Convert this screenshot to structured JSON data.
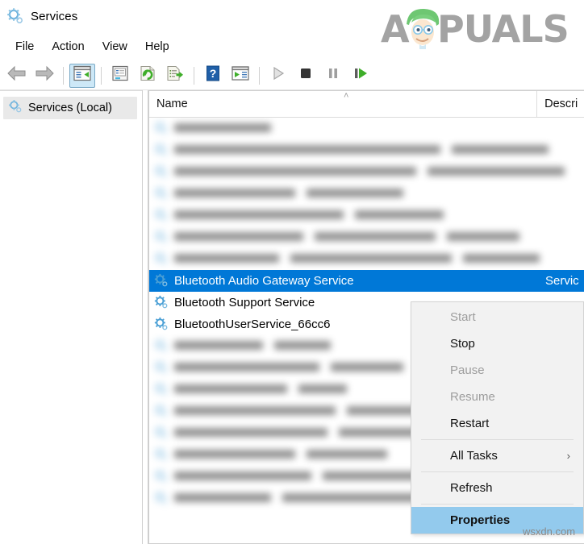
{
  "window": {
    "title": "Services",
    "icon": "services-gear-icon"
  },
  "menubar": {
    "items": [
      {
        "label": "File"
      },
      {
        "label": "Action"
      },
      {
        "label": "View"
      },
      {
        "label": "Help"
      }
    ]
  },
  "toolbar": {
    "buttons": [
      {
        "name": "back-icon",
        "tip": "Back"
      },
      {
        "name": "forward-icon",
        "tip": "Forward"
      },
      {
        "name": "show-hide-console-tree-icon",
        "tip": "Show/Hide Console Tree",
        "active": true
      },
      {
        "name": "properties-icon",
        "tip": "Properties"
      },
      {
        "name": "refresh-icon",
        "tip": "Refresh"
      },
      {
        "name": "export-list-icon",
        "tip": "Export List"
      },
      {
        "name": "help-icon",
        "tip": "Help"
      },
      {
        "name": "show-action-pane-icon",
        "tip": "Show/Hide Action Pane"
      },
      {
        "name": "start-service-icon",
        "tip": "Start Service"
      },
      {
        "name": "stop-service-icon",
        "tip": "Stop Service"
      },
      {
        "name": "pause-service-icon",
        "tip": "Pause Service"
      },
      {
        "name": "restart-service-icon",
        "tip": "Restart Service"
      }
    ]
  },
  "tree": {
    "root_label": "Services (Local)"
  },
  "list": {
    "columns": [
      {
        "key": "name",
        "label": "Name",
        "sorted": "ascending",
        "sort_glyph": "˄"
      },
      {
        "key": "description",
        "label": "Descri"
      }
    ],
    "rows": [
      {
        "name": "",
        "description": "",
        "blurred": true,
        "selected": false
      },
      {
        "name": "",
        "description": "",
        "blurred": true,
        "selected": false
      },
      {
        "name": "",
        "description": "",
        "blurred": true,
        "selected": false
      },
      {
        "name": "",
        "description": "",
        "blurred": true,
        "selected": false
      },
      {
        "name": "",
        "description": "",
        "blurred": true,
        "selected": false
      },
      {
        "name": "",
        "description": "",
        "blurred": true,
        "selected": false
      },
      {
        "name": "",
        "description": "",
        "blurred": true,
        "selected": false
      },
      {
        "name": "Bluetooth Audio Gateway Service",
        "description": "Servic",
        "blurred": false,
        "selected": true
      },
      {
        "name": "Bluetooth Support Service",
        "description": "",
        "blurred": false,
        "selected": false
      },
      {
        "name": "BluetoothUserService_66cc6",
        "description": "",
        "blurred": false,
        "selected": false
      },
      {
        "name": "",
        "description": "",
        "blurred": true,
        "selected": false
      },
      {
        "name": "",
        "description": "",
        "blurred": true,
        "selected": false
      },
      {
        "name": "",
        "description": "",
        "blurred": true,
        "selected": false
      },
      {
        "name": "",
        "description": "",
        "blurred": true,
        "selected": false
      },
      {
        "name": "",
        "description": "",
        "blurred": true,
        "selected": false
      },
      {
        "name": "",
        "description": "",
        "blurred": true,
        "selected": false
      },
      {
        "name": "",
        "description": "",
        "blurred": true,
        "selected": false
      },
      {
        "name": "",
        "description": "",
        "blurred": true,
        "selected": false
      }
    ]
  },
  "context_menu": {
    "items": [
      {
        "label": "Start",
        "disabled": true,
        "highlight": false,
        "separator_after": false,
        "submenu": false
      },
      {
        "label": "Stop",
        "disabled": false,
        "highlight": false,
        "separator_after": false,
        "submenu": false
      },
      {
        "label": "Pause",
        "disabled": true,
        "highlight": false,
        "separator_after": false,
        "submenu": false
      },
      {
        "label": "Resume",
        "disabled": true,
        "highlight": false,
        "separator_after": false,
        "submenu": false
      },
      {
        "label": "Restart",
        "disabled": false,
        "highlight": false,
        "separator_after": true,
        "submenu": false
      },
      {
        "label": "All Tasks",
        "disabled": false,
        "highlight": false,
        "separator_after": true,
        "submenu": true,
        "submenu_glyph": "›"
      },
      {
        "label": "Refresh",
        "disabled": false,
        "highlight": false,
        "separator_after": true,
        "submenu": false
      },
      {
        "label": "Properties",
        "disabled": false,
        "highlight": true,
        "separator_after": false,
        "submenu": false
      }
    ]
  },
  "watermarks": {
    "brand": "APPUALS",
    "brand_prefix": "A",
    "brand_suffix": "PUALS",
    "site": "wsxdn.com"
  },
  "colors": {
    "selection_blue": "#0078d7",
    "menu_highlight": "#93caed",
    "toolbar_active": "#cde8f7",
    "gear_blue": "#4a9fd5",
    "accent_green": "#3fae2a"
  }
}
